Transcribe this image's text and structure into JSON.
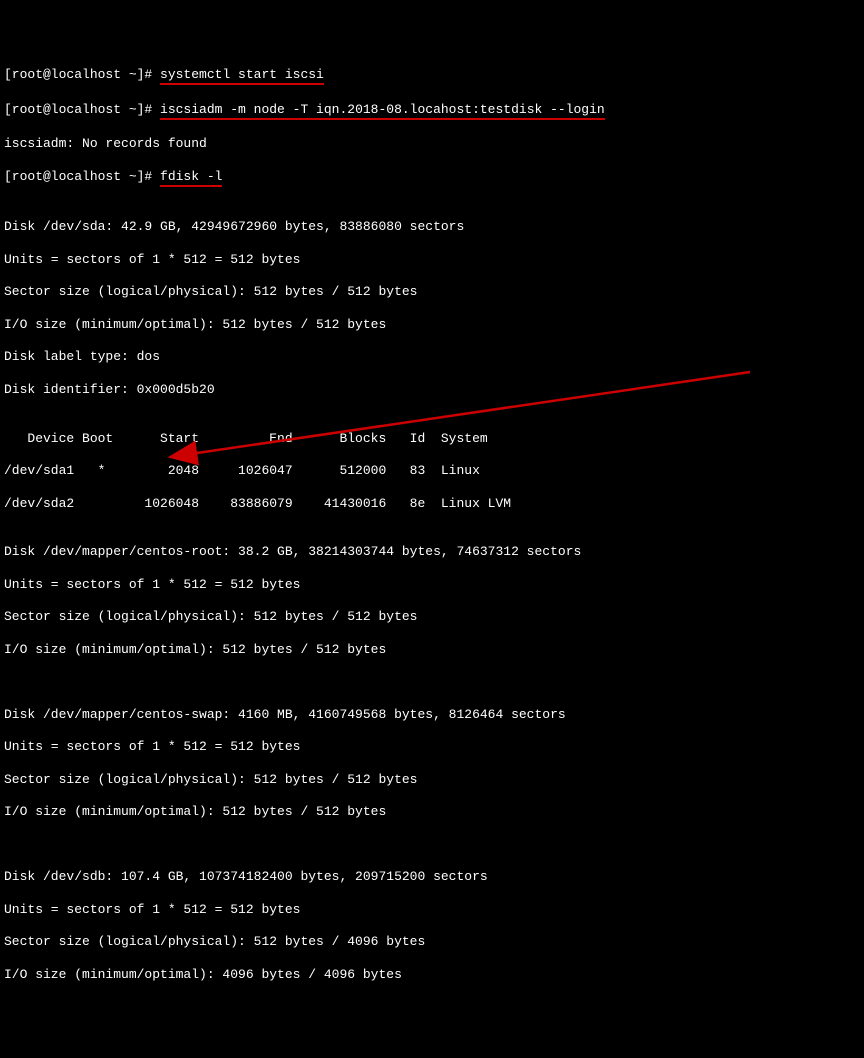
{
  "lines": {
    "l0_prompt": "[root@localhost ~]# ",
    "l0_cmd": "systemctl start iscsi",
    "l1_prompt": "[root@localhost ~]# ",
    "l1_cmd": "iscsiadm -m node -T iqn.2018-08.locahost:testdisk --login",
    "l2": "iscsiadm: No records found",
    "l3_prompt": "[root@localhost ~]# ",
    "l3_cmd": "fdisk -l",
    "l4": "",
    "l5": "Disk /dev/sda: 42.9 GB, 42949672960 bytes, 83886080 sectors",
    "l6": "Units = sectors of 1 * 512 = 512 bytes",
    "l7": "Sector size (logical/physical): 512 bytes / 512 bytes",
    "l8": "I/O size (minimum/optimal): 512 bytes / 512 bytes",
    "l9": "Disk label type: dos",
    "l10": "Disk identifier: 0x000d5b20",
    "l11": "",
    "l12": "   Device Boot      Start         End      Blocks   Id  System",
    "l13": "/dev/sda1   *        2048     1026047      512000   83  Linux",
    "l14": "/dev/sda2         1026048    83886079    41430016   8e  Linux LVM",
    "l15": "",
    "l16": "Disk /dev/mapper/centos-root: 38.2 GB, 38214303744 bytes, 74637312 sectors",
    "l17": "Units = sectors of 1 * 512 = 512 bytes",
    "l18": "Sector size (logical/physical): 512 bytes / 512 bytes",
    "l19": "I/O size (minimum/optimal): 512 bytes / 512 bytes",
    "l20": "",
    "l21": "",
    "l22": "Disk /dev/mapper/centos-swap: 4160 MB, 4160749568 bytes, 8126464 sectors",
    "l23": "Units = sectors of 1 * 512 = 512 bytes",
    "l24": "Sector size (logical/physical): 512 bytes / 512 bytes",
    "l25": "I/O size (minimum/optimal): 512 bytes / 512 bytes",
    "l26": "",
    "l27": "",
    "l28": "Disk /dev/sdb: 107.4 GB, 107374182400 bytes, 209715200 sectors",
    "l29": "Units = sectors of 1 * 512 = 512 bytes",
    "l30": "Sector size (logical/physical): 512 bytes / 4096 bytes",
    "l31": "I/O size (minimum/optimal): 4096 bytes / 4096 bytes"
  }
}
